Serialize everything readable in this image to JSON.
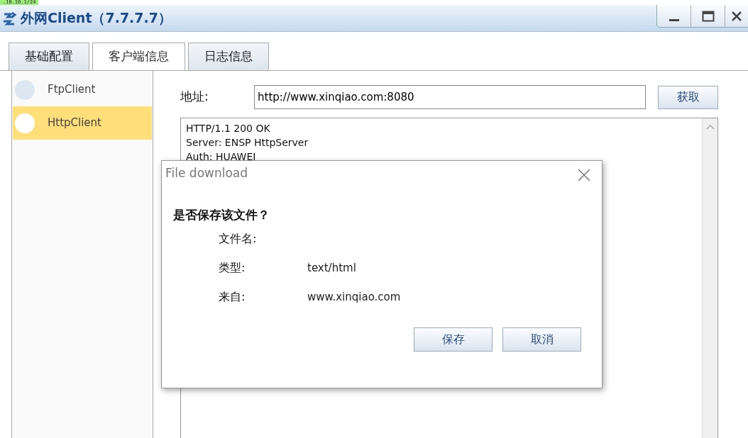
{
  "top_strip": {
    "text": ".10.10.1/24"
  },
  "window": {
    "title": "外网Client（7.7.7.7）"
  },
  "tabs": [
    {
      "label": "基础配置",
      "selected": false
    },
    {
      "label": "客户端信息",
      "selected": true
    },
    {
      "label": "日志信息",
      "selected": false
    }
  ],
  "sidebar": {
    "items": [
      {
        "label": "FtpClient",
        "selected": false
      },
      {
        "label": "HttpClient",
        "selected": true
      }
    ]
  },
  "address": {
    "label": "地址:",
    "value": "http://www.xinqiao.com:8080",
    "button": "获取"
  },
  "response": {
    "lines": [
      "HTTP/1.1 200 OK",
      "Server: ENSP HttpServer",
      "Auth: HUAWEI"
    ]
  },
  "dialog": {
    "title": "File download",
    "question": "是否保存该文件？",
    "fields": [
      {
        "label": "文件名:"
      },
      {
        "label": "类型:",
        "value": "text/html"
      },
      {
        "label": "来自:",
        "value": "www.xinqiao.com"
      }
    ],
    "buttons": [
      "保存",
      "取消"
    ]
  }
}
